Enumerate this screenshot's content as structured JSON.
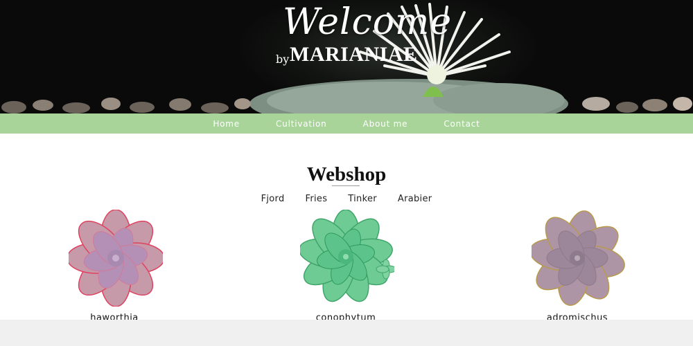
{
  "hero": {
    "script_title": "Welcome",
    "by_text": "by",
    "brand": "MARIANIAE"
  },
  "nav": {
    "items": [
      {
        "label": "Home"
      },
      {
        "label": "Cultivation"
      },
      {
        "label": "About me"
      },
      {
        "label": "Contact"
      }
    ],
    "color": "#a8d49a"
  },
  "shop": {
    "title": "Webshop",
    "filters": [
      {
        "label": "Fjord"
      },
      {
        "label": "Fries"
      },
      {
        "label": "Tinker"
      },
      {
        "label": "Arabier"
      }
    ],
    "products": [
      {
        "name": "haworthia",
        "image": "pink-succulent-icon",
        "color": "#b58fb8"
      },
      {
        "name": "conophytum",
        "image": "green-succulent-icon",
        "color": "#5cc48a"
      },
      {
        "name": "adromischus",
        "image": "mauve-succulent-icon",
        "color": "#a68aa0"
      }
    ]
  }
}
